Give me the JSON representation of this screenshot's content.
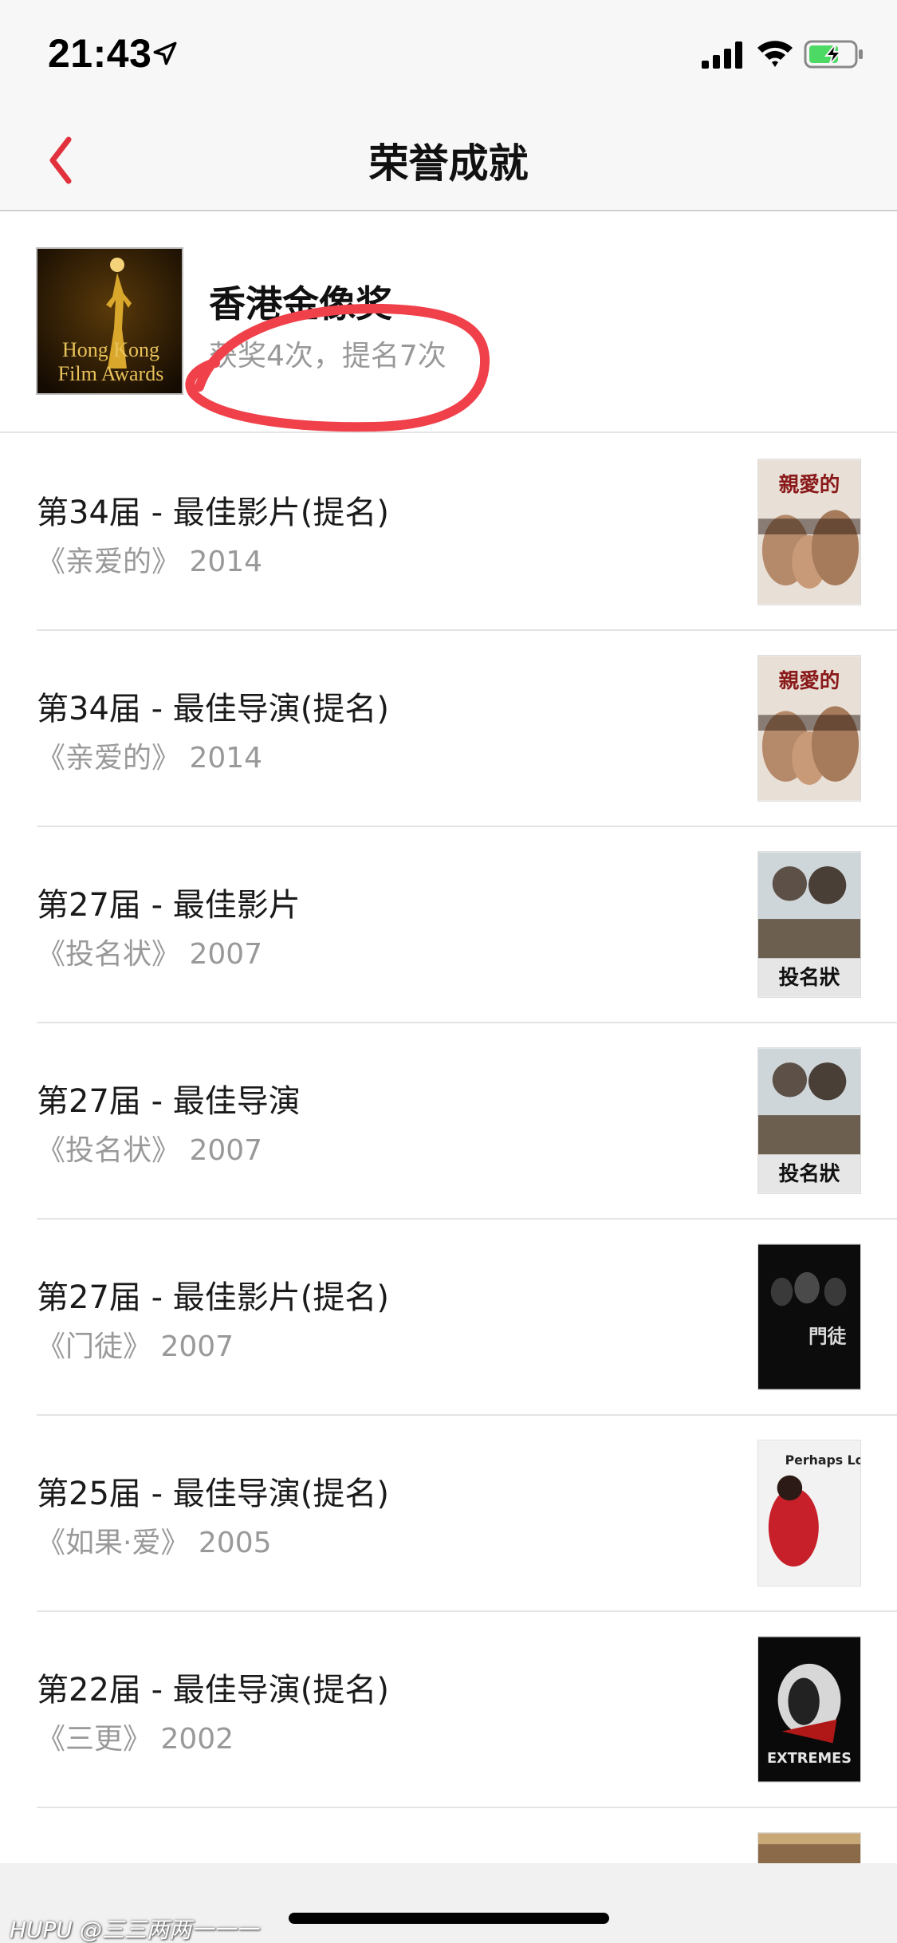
{
  "status_bar": {
    "time": "21:43"
  },
  "nav": {
    "title": "荣誉成就"
  },
  "award": {
    "name": "香港金像奖",
    "stats": "获奖4次，提名7次",
    "logo_line1": "Hong Kong",
    "logo_line2": "Film Awards"
  },
  "items": [
    {
      "title": "第34届 - 最佳影片(提名)",
      "subtitle": "《亲爱的》 2014",
      "poster_text": "親愛的"
    },
    {
      "title": "第34届 - 最佳导演(提名)",
      "subtitle": "《亲爱的》 2014",
      "poster_text": "親愛的"
    },
    {
      "title": "第27届 - 最佳影片",
      "subtitle": "《投名状》 2007",
      "poster_text": "投名狀"
    },
    {
      "title": "第27届 - 最佳导演",
      "subtitle": "《投名状》 2007",
      "poster_text": "投名狀"
    },
    {
      "title": "第27届 - 最佳影片(提名)",
      "subtitle": "《门徒》 2007",
      "poster_text": "門徒"
    },
    {
      "title": "第25届 - 最佳导演(提名)",
      "subtitle": "《如果·爱》 2005",
      "poster_text": "Perhaps Love"
    },
    {
      "title": "第22届 - 最佳导演(提名)",
      "subtitle": "《三更》 2002",
      "poster_text": "EXTREMES"
    }
  ],
  "watermark": "HUPU @三三两两一一一",
  "colors": {
    "accent": "#e0313c",
    "annotation": "#f0414b"
  }
}
